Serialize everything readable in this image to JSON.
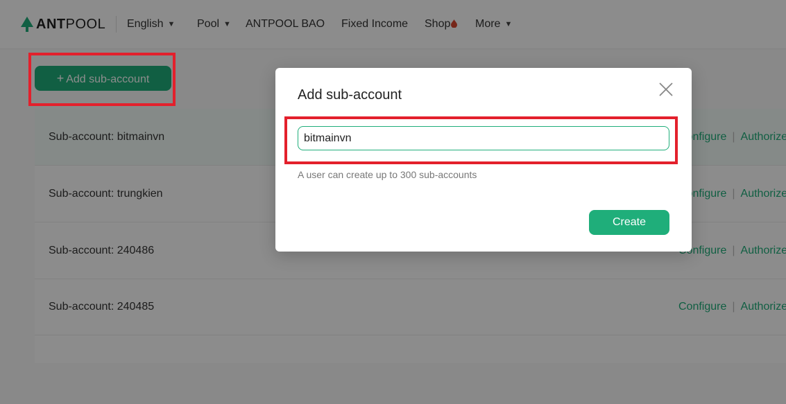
{
  "header": {
    "logo": {
      "strong": "ANT",
      "rest": "POOL"
    },
    "language": "English",
    "nav": {
      "pool": "Pool",
      "antpool_bao": "ANTPOOL BAO",
      "fixed_income": "Fixed Income",
      "shop": "Shop",
      "more": "More"
    }
  },
  "toolbar": {
    "add_label": "Add sub-account"
  },
  "subaccounts": {
    "rows": [
      {
        "label": "Sub-account: bitmainvn"
      },
      {
        "label": "Sub-account: trungkien"
      },
      {
        "label": "Sub-account: 240486"
      },
      {
        "label": "Sub-account: 240485"
      }
    ],
    "configure_label": "Configure",
    "authorize_label": "Authorize",
    "separator": "|"
  },
  "modal": {
    "title": "Add sub-account",
    "input_value": "bitmainvn",
    "hint": "A user can create up to 300 sub-accounts",
    "create_label": "Create"
  },
  "colors": {
    "brand_green": "#1fae7a",
    "annotation_red": "#e3202c"
  }
}
